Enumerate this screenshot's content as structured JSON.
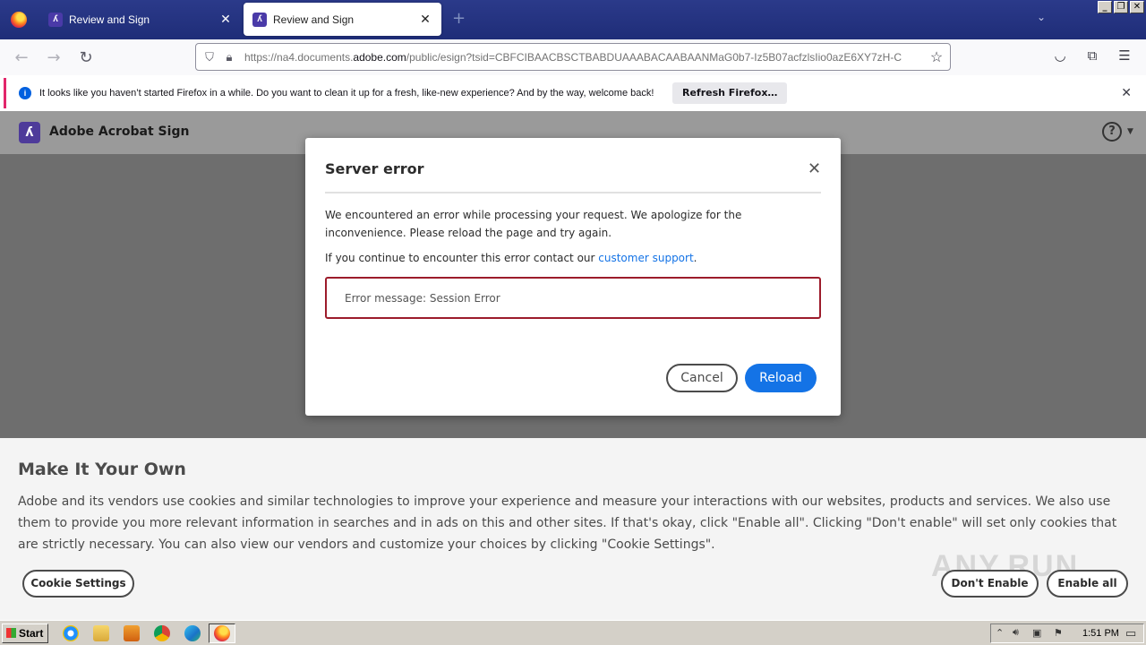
{
  "browser": {
    "tabs": [
      {
        "title": "Review and Sign",
        "active": false
      },
      {
        "title": "Review and Sign",
        "active": true
      }
    ],
    "new_tab": "+",
    "url": {
      "prefix": "https://na4.documents.",
      "host": "adobe.com",
      "path": "/public/esign?tsid=CBFCIBAACBSCTBABDUAAABACAABAANMaG0b7-Iz5B07acfzlsIio0azE6XY7zH-C"
    },
    "notification": {
      "text": "It looks like you haven’t started Firefox in a while. Do you want to clean it up for a fresh, like-new experience? And by the way, welcome back!",
      "button": "Refresh Firefox…"
    }
  },
  "app": {
    "name": "Adobe Acrobat Sign",
    "help": "?"
  },
  "dialog": {
    "title": "Server error",
    "message": "We encountered an error while processing your request. We apologize for the inconvenience. Please reload the page and try again.",
    "contact_prefix": "If you continue to encounter this error contact our ",
    "contact_link": "customer support",
    "contact_suffix": ".",
    "error_message": "Error message: Session Error",
    "cancel": "Cancel",
    "reload": "Reload"
  },
  "cookie_banner": {
    "title": "Make It Your Own",
    "text": "Adobe and its vendors use cookies and similar technologies to improve your experience and measure your interactions with our websites, products and services. We also use them to provide you more relevant information in searches and in ads on this and other sites. If that's okay, click \"Enable all\". Clicking \"Don't enable\" will set only cookies that are strictly necessary. You can also view our vendors and customize your choices by clicking \"Cookie Settings\".",
    "settings": "Cookie Settings",
    "dont_enable": "Don't Enable",
    "enable_all": "Enable all"
  },
  "watermark": "ANY.RUN",
  "taskbar": {
    "start": "Start",
    "clock": "1:51 PM"
  },
  "colors": {
    "accent": "#1473e6",
    "error_border": "#9c1c2b",
    "tabbar": "#23328a"
  }
}
